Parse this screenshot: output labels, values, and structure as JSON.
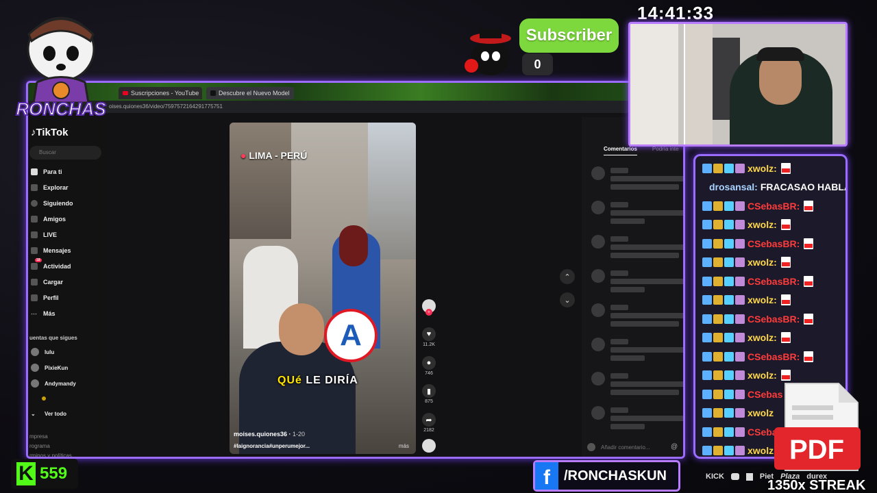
{
  "overlay": {
    "clock": "14:41:33",
    "subscriber_label": "Subscriber",
    "subscriber_count": "0",
    "kick_count": "559",
    "facebook_handle": "/RONCHASKUN",
    "streak": "1350x STREAK",
    "mascot_text": "RONCHAS",
    "brand_strip": [
      "KICK",
      "Piet",
      "Plaza",
      "durex"
    ],
    "pdf_label": "PDF",
    "accent_color": "#9b6cff",
    "subscriber_color": "#7cd83c",
    "kick_color": "#53fc18"
  },
  "chat": [
    {
      "name": "xwolz:",
      "name_color": "#ffd84a",
      "text": "",
      "pdf": true
    },
    {
      "name": "drosansal:",
      "name_color": "#aad4ff",
      "text": "FRACASAO HABLA",
      "pdf": false
    },
    {
      "name": "CSebasBR:",
      "name_color": "#ff3b3b",
      "text": "",
      "pdf": true
    },
    {
      "name": "xwolz:",
      "name_color": "#ffd84a",
      "text": "",
      "pdf": true
    },
    {
      "name": "CSebasBR:",
      "name_color": "#ff3b3b",
      "text": "",
      "pdf": true
    },
    {
      "name": "xwolz:",
      "name_color": "#ffd84a",
      "text": "",
      "pdf": true
    },
    {
      "name": "CSebasBR:",
      "name_color": "#ff3b3b",
      "text": "",
      "pdf": true
    },
    {
      "name": "xwolz:",
      "name_color": "#ffd84a",
      "text": "",
      "pdf": true
    },
    {
      "name": "CSebasBR:",
      "name_color": "#ff3b3b",
      "text": "",
      "pdf": true
    },
    {
      "name": "xwolz:",
      "name_color": "#ffd84a",
      "text": "",
      "pdf": true
    },
    {
      "name": "CSebasBR:",
      "name_color": "#ff3b3b",
      "text": "",
      "pdf": true
    },
    {
      "name": "xwolz:",
      "name_color": "#ffd84a",
      "text": "",
      "pdf": true
    },
    {
      "name": "CSebas",
      "name_color": "#ff3b3b",
      "text": "",
      "pdf": false
    },
    {
      "name": "xwolz",
      "name_color": "#ffd84a",
      "text": "",
      "pdf": false
    },
    {
      "name": "CSebas",
      "name_color": "#ff3b3b",
      "text": "",
      "pdf": false
    },
    {
      "name": "xwolz",
      "name_color": "#ffd84a",
      "text": "",
      "pdf": false
    }
  ],
  "browser": {
    "tabs": [
      "Suscripciones - YouTube",
      "Descubre el Nuevo Model"
    ],
    "url": "oises.quiones36/video/7597572164291775751"
  },
  "tiktok": {
    "logo": "TikTok",
    "search_placeholder": "Buscar",
    "nav": [
      "Para ti",
      "Explorar",
      "Siguiendo",
      "Amigos",
      "LIVE",
      "Mensajes",
      "Actividad",
      "Cargar",
      "Perfil",
      "Más"
    ],
    "activity_badge": "18",
    "following_title": "uentas que sigues",
    "following": [
      "lulu",
      "PixieKun",
      "Andymandy",
      "",
      "Ver todo"
    ],
    "footer_links": [
      "mpresa",
      "rograma",
      "rminos y políticas"
    ],
    "video": {
      "location": "LIMA - PERÚ",
      "caption_yellow": "QUé",
      "caption_white": "LE DIRÍA",
      "author": "moises.quiones36",
      "date": "1-20",
      "tags": "#laignorancia#unperumejor...",
      "more": "más",
      "a_logo": "A"
    },
    "actions": {
      "likes": "11.2K",
      "comments": "746",
      "saves": "875",
      "shares": "2182"
    },
    "comments_tabs": [
      "Comentarios",
      "Podría inte"
    ],
    "comment_placeholder": "Añadir comentario..."
  }
}
